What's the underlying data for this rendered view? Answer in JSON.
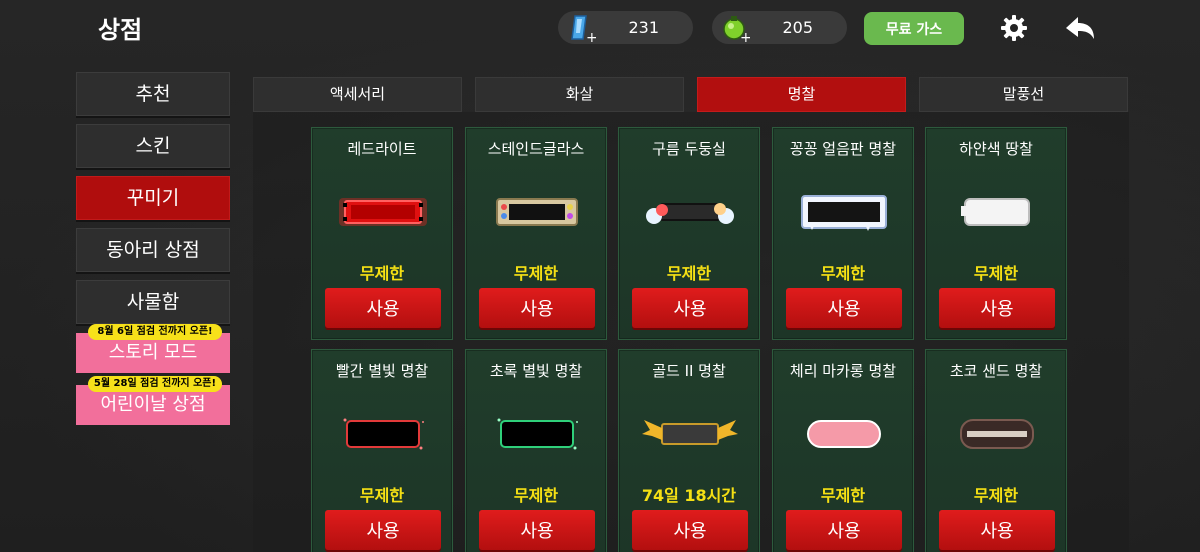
{
  "header": {
    "title": "상점",
    "gems": "231",
    "potions": "205",
    "free_gas_label": "무료 가스",
    "gem_icon": "blue-gem-icon",
    "potion_icon": "green-potion-icon",
    "settings_icon": "gear-icon",
    "back_icon": "back-arrow-icon"
  },
  "sidebar": {
    "items": [
      {
        "label": "추천"
      },
      {
        "label": "스킨"
      },
      {
        "label": "꾸미기"
      },
      {
        "label": "동아리 상점"
      },
      {
        "label": "사물함"
      }
    ],
    "promos": [
      {
        "badge": "8월 6일 점검 전까지 오픈!",
        "label": "스토리 모드"
      },
      {
        "badge": "5월 28일 점검 전까지 오픈!",
        "label": "어린이날 상점"
      }
    ]
  },
  "tabs": [
    {
      "label": "액세서리"
    },
    {
      "label": "화살"
    },
    {
      "label": "명찰"
    },
    {
      "label": "말풍선"
    }
  ],
  "cards": [
    {
      "name": "레드라이트",
      "duration": "무제한",
      "button": "사용"
    },
    {
      "name": "스테인드글라스",
      "duration": "무제한",
      "button": "사용"
    },
    {
      "name": "구름 두둥실",
      "duration": "무제한",
      "button": "사용"
    },
    {
      "name": "꽁꽁 얼음판 명찰",
      "duration": "무제한",
      "button": "사용"
    },
    {
      "name": "하얀색 땅찰",
      "duration": "무제한",
      "button": "사용"
    },
    {
      "name": "빨간 별빛 명찰",
      "duration": "무제한",
      "button": "사용"
    },
    {
      "name": "초록 별빛 명찰",
      "duration": "무제한",
      "button": "사용"
    },
    {
      "name": "골드 II 명찰",
      "duration": "74일 18시간",
      "button": "사용"
    },
    {
      "name": "체리 마카롱 명찰",
      "duration": "무제한",
      "button": "사용"
    },
    {
      "name": "초코 샌드 명찰",
      "duration": "무제한",
      "button": "사용"
    }
  ],
  "colors": {
    "accent_red": "#b00d0d",
    "card_green": "#203d2b",
    "duration_yellow": "#f5e014",
    "free_gas_green": "#6ab94e",
    "promo_pink": "#f26f9b"
  }
}
